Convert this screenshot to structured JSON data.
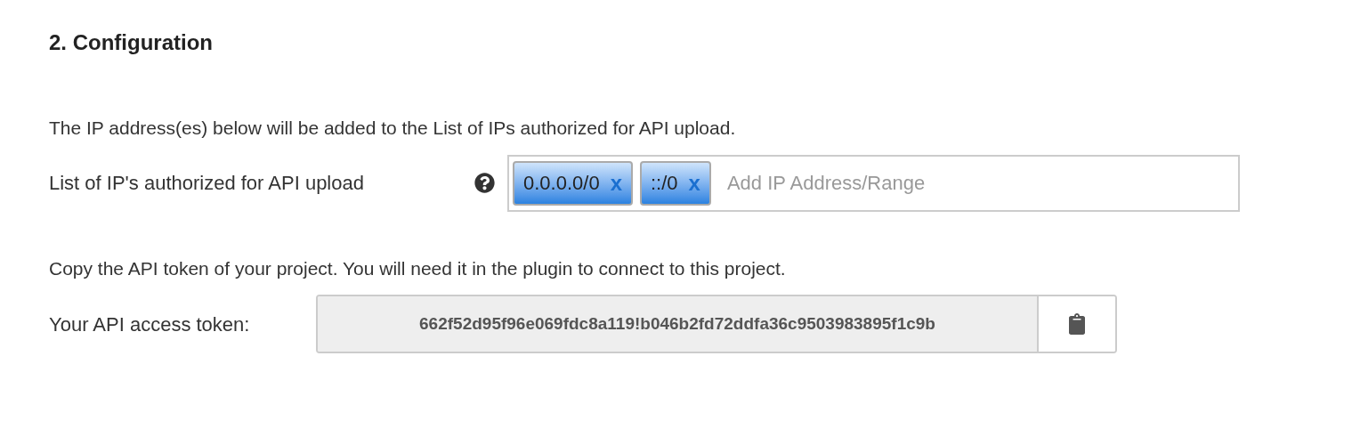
{
  "section_title": "2. Configuration",
  "ip_section": {
    "description": "The IP address(es) below will be added to the List of IPs authorized for API upload.",
    "label": "List of IP's authorized for API upload",
    "tags": [
      {
        "value": "0.0.0.0/0",
        "remove": "x"
      },
      {
        "value": "::/0",
        "remove": "x"
      }
    ],
    "placeholder": "Add IP Address/Range"
  },
  "token_section": {
    "description": "Copy the API token of your project. You will need it in the plugin to connect to this project.",
    "label": "Your API access token:",
    "token": "662f52d95f96e069fdc8a119!b046b2fd72ddfa36c9503983895f1c9b"
  }
}
